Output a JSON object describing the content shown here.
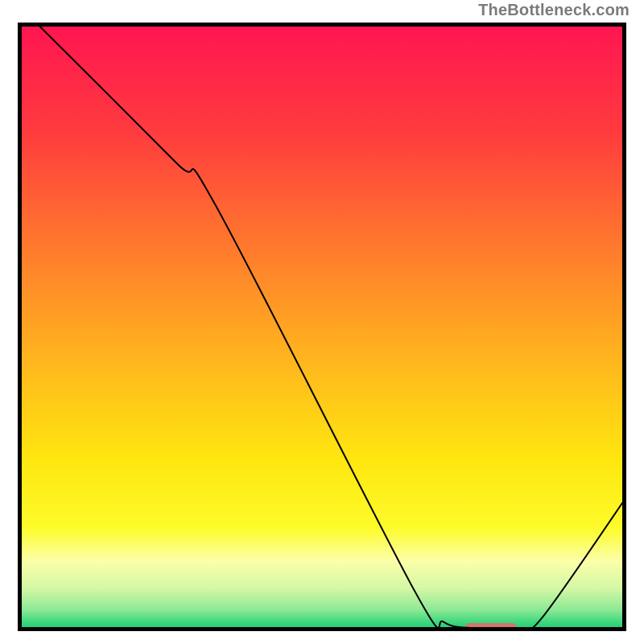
{
  "attribution": "TheBottleneck.com",
  "chart_data": {
    "type": "line",
    "title": "",
    "xlabel": "",
    "ylabel": "",
    "xlim": [
      0,
      100
    ],
    "ylim": [
      0,
      100
    ],
    "series": [
      {
        "name": "curve",
        "points": [
          [
            3,
            100
          ],
          [
            26,
            77
          ],
          [
            32.5,
            70
          ],
          [
            65,
            7
          ],
          [
            70,
            1.5
          ],
          [
            75,
            0.5
          ],
          [
            82,
            0.5
          ],
          [
            86,
            2
          ],
          [
            100,
            22
          ]
        ],
        "stroke": "#000000",
        "stroke_width": 2
      }
    ],
    "highlight_segment": {
      "x0": 73.5,
      "x1": 82,
      "y": 0.6,
      "color": "#d4746f",
      "thickness": 11,
      "rounded": true
    },
    "background_gradient": {
      "stops": [
        {
          "offset": 0.0,
          "color": "#ff1452"
        },
        {
          "offset": 0.18,
          "color": "#ff3b3e"
        },
        {
          "offset": 0.38,
          "color": "#ff7d2c"
        },
        {
          "offset": 0.55,
          "color": "#ffb41e"
        },
        {
          "offset": 0.72,
          "color": "#ffe70f"
        },
        {
          "offset": 0.83,
          "color": "#fdfb2a"
        },
        {
          "offset": 0.885,
          "color": "#fbffa8"
        },
        {
          "offset": 0.93,
          "color": "#d4f7a5"
        },
        {
          "offset": 0.965,
          "color": "#8ce995"
        },
        {
          "offset": 0.985,
          "color": "#3fd87f"
        },
        {
          "offset": 1.0,
          "color": "#17c574"
        }
      ]
    },
    "border": {
      "color": "#000000",
      "width": 5
    }
  }
}
